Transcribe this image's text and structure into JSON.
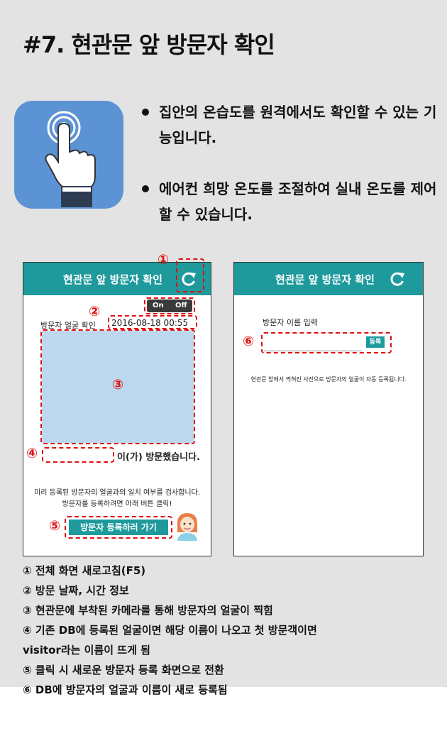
{
  "header": {
    "title": "#7. 현관문 앞 방문자 확인"
  },
  "bullets": [
    "집안의 온습도를 원격에서도 확인할 수 있는 기능입니다.",
    "에어컨 희망 온도를 조절하여 실내 온도를 제어할 수 있습니다."
  ],
  "markers": {
    "m1": "①",
    "m2": "②",
    "m3": "③",
    "m4": "④",
    "m5": "⑤",
    "m6": "⑥"
  },
  "phone1": {
    "title": "현관문 앞 방문자 확인",
    "toggle_on": "On",
    "toggle_off": "Off",
    "face_label": "방문자 얼굴 확인",
    "datetime": "2016-08-18 00:55",
    "visited_suffix": "이(가) 방문했습니다.",
    "info_line1": "미리 등록된 방문자의 얼굴과의 일치 여부를 검사합니다.",
    "info_line2": "방문자를 등록하려면 아래 버튼 클릭!",
    "register_button": "방문자 등록하러 가기"
  },
  "phone2": {
    "title": "현관문 앞 방문자 확인",
    "name_label": "방문자 이름 입력",
    "name_value": "",
    "submit_button": "등록",
    "info": "현관문 앞에서 찍혀진 사진으로 방문자의 얼굴이 자동 등록됩니다."
  },
  "notes": [
    "① 전체 화면 새로고침(F5)",
    "② 방문 날짜, 시간 정보",
    "③ 현관문에 부착된 카메라를 통해 방문자의 얼굴이 찍힘",
    "④ 기존 DB에 등록된 얼굴이면 해당 이름이 나오고 첫 방문객이면",
    "visitor라는 이름이 뜨게 됨",
    "⑤ 클릭 시 새로운 방문자 등록 화면으로 전환",
    "⑥ DB에 방문자의 얼굴과 이름이 새로 등록됨"
  ],
  "colors": {
    "teal": "#1e9a9c",
    "marker_red": "#e01010",
    "icon_blue": "#5b93d4",
    "camera_blue": "#bcd7ee",
    "background": "#e3e3e3"
  },
  "icons": [
    "hand-touch-icon",
    "refresh-icon",
    "avatar-icon"
  ]
}
